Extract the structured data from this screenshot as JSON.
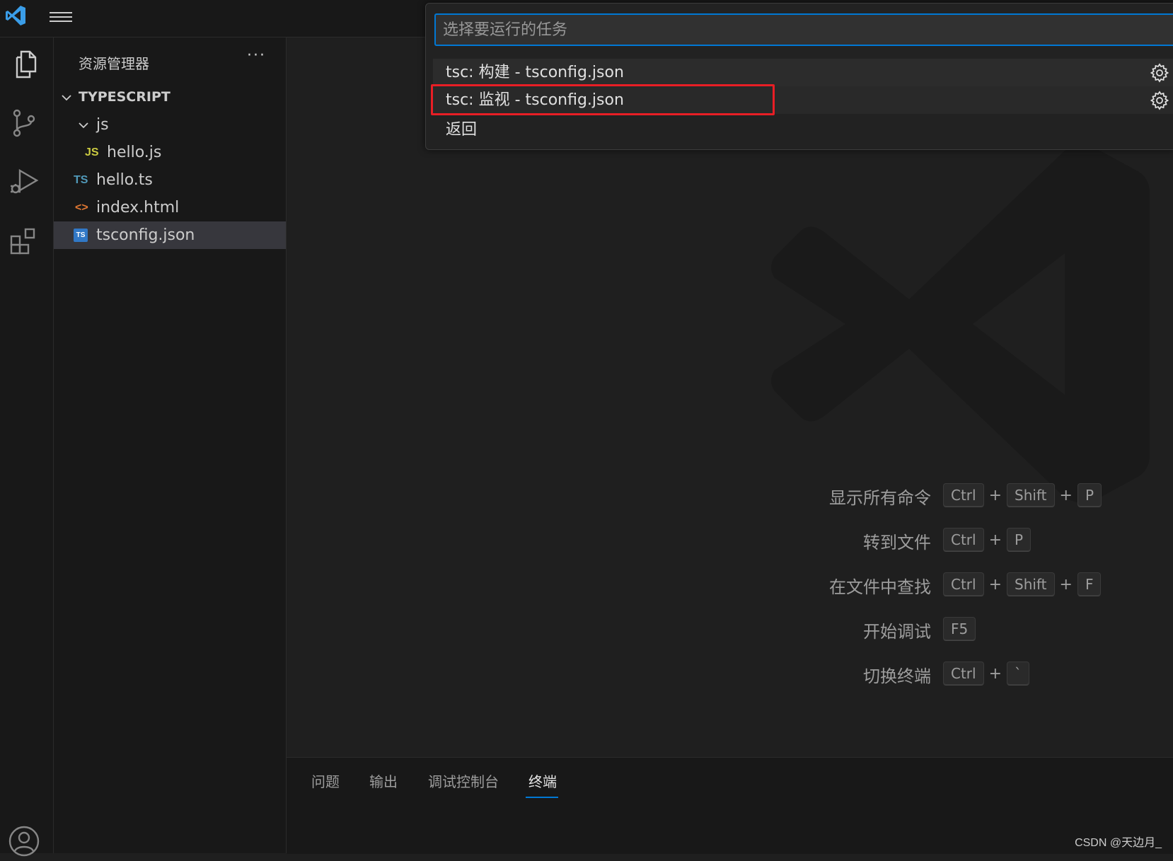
{
  "sidebar": {
    "title": "资源管理器",
    "more": "···",
    "tree": [
      {
        "label": "TYPESCRIPT"
      },
      {
        "label": "js"
      },
      {
        "label": "hello.js",
        "icon": "JS"
      },
      {
        "label": "hello.ts",
        "icon": "TS"
      },
      {
        "label": "index.html",
        "icon": "<>"
      },
      {
        "label": "tsconfig.json",
        "icon": "TS"
      }
    ]
  },
  "quickpick": {
    "placeholder": "选择要运行的任务",
    "items": [
      {
        "label": "tsc: 构建 - tsconfig.json"
      },
      {
        "label": "tsc: 监视 - tsconfig.json"
      },
      {
        "label": "返回"
      }
    ]
  },
  "shortcuts": [
    {
      "label": "显示所有命令",
      "keys": [
        "Ctrl",
        "Shift",
        "P"
      ]
    },
    {
      "label": "转到文件",
      "keys": [
        "Ctrl",
        "P"
      ]
    },
    {
      "label": "在文件中查找",
      "keys": [
        "Ctrl",
        "Shift",
        "F"
      ]
    },
    {
      "label": "开始调试",
      "keys": [
        "F5"
      ]
    },
    {
      "label": "切换终端",
      "keys": [
        "Ctrl",
        "`"
      ]
    }
  ],
  "shortcut_plus": "+",
  "panel": {
    "tabs": [
      "问题",
      "输出",
      "调试控制台",
      "终端"
    ],
    "active_tab": "终端"
  },
  "credit": "CSDN @天边月_",
  "colors": {
    "accent": "#0078d4",
    "highlight_box": "#e81e25",
    "js_icon": "#cbcb41",
    "ts_icon": "#519aba",
    "html_icon": "#e37933"
  }
}
